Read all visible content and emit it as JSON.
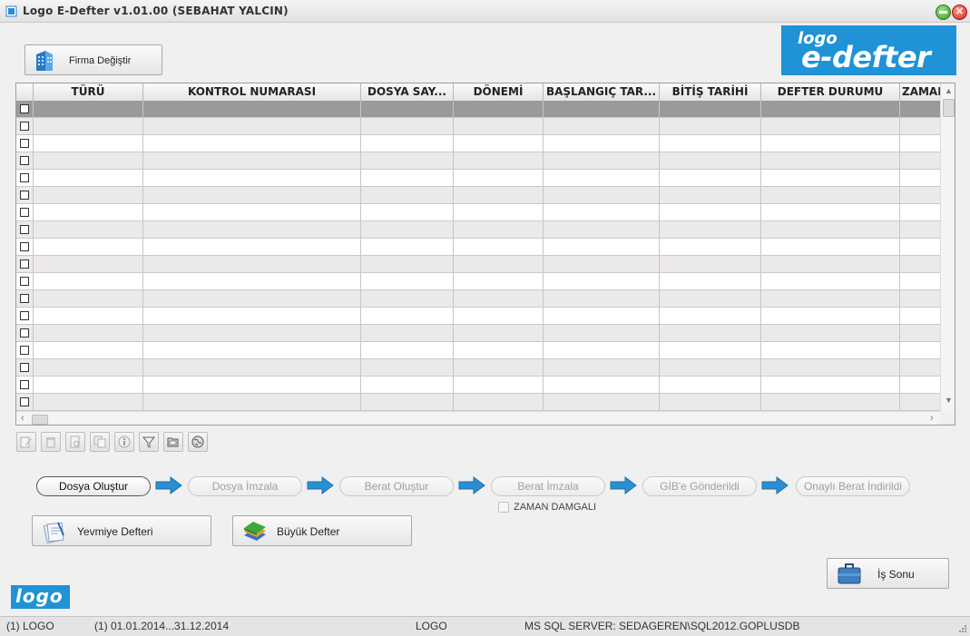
{
  "window": {
    "title": "Logo E-Defter v1.01.00 (SEBAHAT YALCIN)"
  },
  "toolbar_top": {
    "firma_button": "Firma Değiştir"
  },
  "brand": {
    "logo_small": "logo",
    "logo_big": "e-defter"
  },
  "grid": {
    "columns": [
      {
        "label": "TÜRÜ"
      },
      {
        "label": "KONTROL NUMARASI"
      },
      {
        "label": "DOSYA SAY..."
      },
      {
        "label": "DÖNEMİ"
      },
      {
        "label": "BAŞLANGIÇ TAR..."
      },
      {
        "label": "BİTİŞ TARİHİ"
      },
      {
        "label": "DEFTER DURUMU"
      },
      {
        "label": "ZAMAN"
      }
    ],
    "selected_row": 1,
    "row_count": 18
  },
  "grid_toolbar": [
    {
      "name": "edit-icon"
    },
    {
      "name": "delete-icon"
    },
    {
      "name": "preview-icon"
    },
    {
      "name": "copy-icon"
    },
    {
      "name": "info-icon"
    },
    {
      "name": "filter-icon"
    },
    {
      "name": "open-folder-icon"
    },
    {
      "name": "globe-icon"
    }
  ],
  "workflow": {
    "steps": [
      {
        "label": "Dosya Oluştur",
        "active": true
      },
      {
        "label": "Dosya İmzala",
        "active": false
      },
      {
        "label": "Berat Oluştur",
        "active": false
      },
      {
        "label": "Berat İmzala",
        "active": false
      },
      {
        "label": "GİB'e Gönderildi",
        "active": false
      },
      {
        "label": "Onaylı Berat İndirildi",
        "active": false
      }
    ],
    "timestamp_label": "ZAMAN DAMGALI",
    "timestamp_checked": false
  },
  "books": {
    "journal_button": "Yevmiye Defteri",
    "ledger_button": "Büyük Defter"
  },
  "finish_button": "İş Sonu",
  "footer_logo": "logo",
  "status": {
    "company": "(1) LOGO",
    "period": "(1) 01.01.2014...31.12.2014",
    "user": "LOGO",
    "server": "MS SQL SERVER: SEDAGEREN\\SQL2012.GOPLUSDB"
  },
  "colors": {
    "brand_blue": "#1f93d6",
    "arrow_blue": "#2a8fd0",
    "selected_row": "#9a9a9a",
    "alt_row": "#ece9e9"
  }
}
